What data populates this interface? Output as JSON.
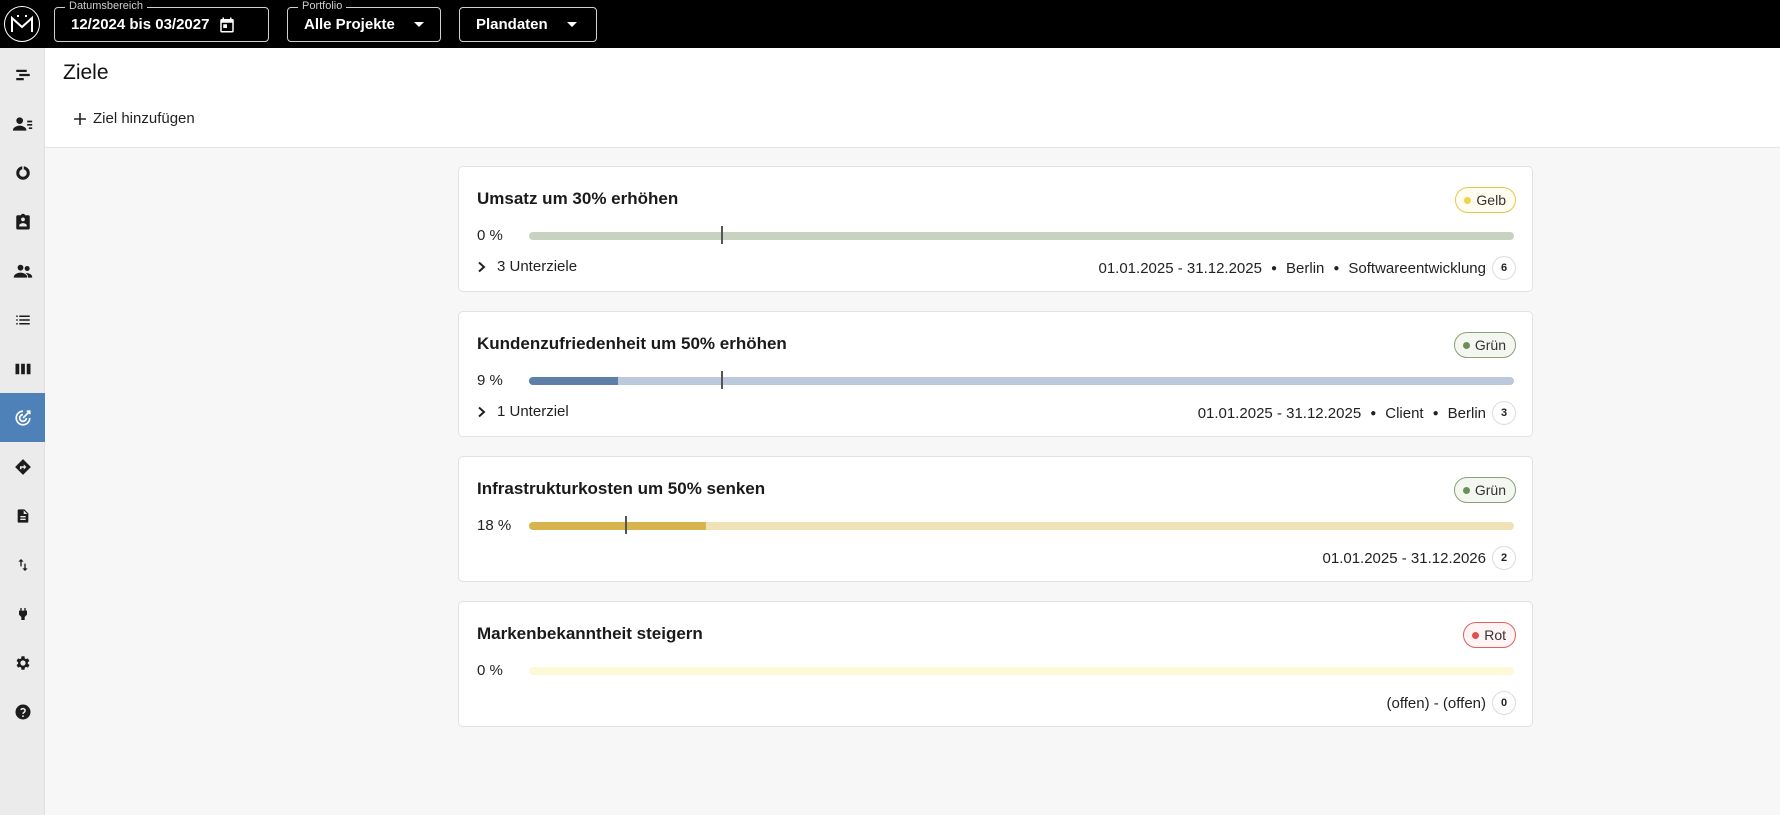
{
  "topbar": {
    "logo_text": "M",
    "date_range": {
      "legend": "Datumsbereich",
      "value": "12/2024 bis 03/2027"
    },
    "portfolio": {
      "legend": "Portfolio",
      "value": "Alle Projekte"
    },
    "data_mode": {
      "value": "Plandaten"
    }
  },
  "sidebar": {
    "items": [
      {
        "icon": "gantt-icon"
      },
      {
        "icon": "user-list-icon"
      },
      {
        "icon": "donut-chart-icon"
      },
      {
        "icon": "badge-clipboard-icon"
      },
      {
        "icon": "people-icon"
      },
      {
        "icon": "list-icon"
      },
      {
        "icon": "board-columns-icon"
      },
      {
        "icon": "target-icon",
        "active": true
      },
      {
        "icon": "roadmap-sign-icon"
      },
      {
        "icon": "document-icon"
      },
      {
        "icon": "swap-vertical-icon"
      },
      {
        "icon": "plug-icon"
      },
      {
        "icon": "gear-icon"
      },
      {
        "icon": "help-icon"
      }
    ]
  },
  "page": {
    "title": "Ziele",
    "add_label": "Ziel hinzufügen"
  },
  "colors": {
    "accent": "#4f81b9",
    "status_gelb": "#f2d34a",
    "status_gruen": "#6f8d5b",
    "status_rot": "#e05050"
  },
  "goals": [
    {
      "title": "Umsatz um 30% erhöhen",
      "status": "Gelb",
      "progress_label": "0 %",
      "progress": 0,
      "sub_label": "3 Unterziele",
      "date_range": "01.01.2025 - 31.12.2025",
      "tags": [
        "Berlin",
        "Softwareentwicklung"
      ],
      "count": "6"
    },
    {
      "title": "Kundenzufriedenheit um 50% erhöhen",
      "status": "Grün",
      "progress_label": "9 %",
      "progress": 0.09,
      "sub_label": "1 Unterziel",
      "date_range": "01.01.2025 - 31.12.2025",
      "tags": [
        "Client",
        "Berlin"
      ],
      "count": "3"
    },
    {
      "title": "Infrastrukturkosten um 50% senken",
      "status": "Grün",
      "progress_label": "18 %",
      "progress": 0.18,
      "sub_label": "",
      "date_range": "01.01.2025 - 31.12.2026",
      "tags": [],
      "count": "2"
    },
    {
      "title": "Markenbekanntheit steigern",
      "status": "Rot",
      "progress_label": "0 %",
      "progress": 0,
      "sub_label": "",
      "date_range": "(offen) - (offen)",
      "tags": [],
      "count": "0"
    }
  ]
}
